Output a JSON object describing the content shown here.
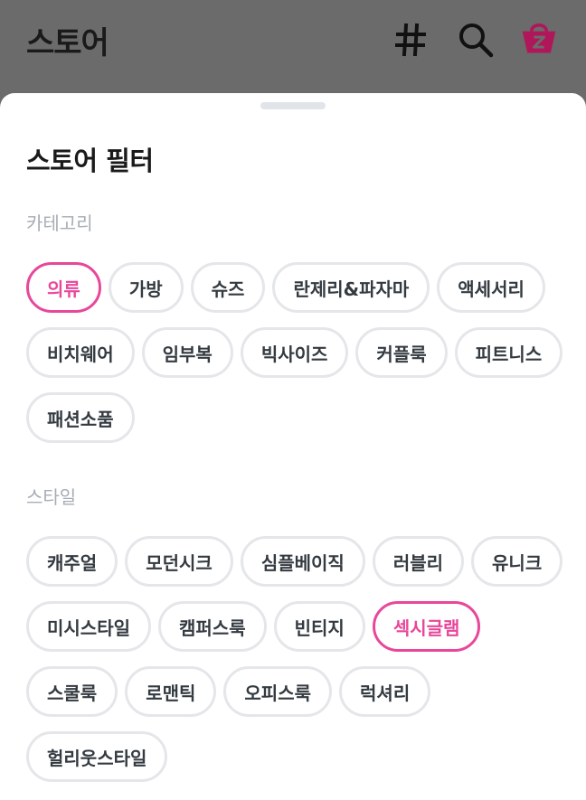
{
  "header": {
    "title": "스토어",
    "hash_icon": "hash-icon",
    "search_icon": "search-icon",
    "bag_icon": "shopping-bag-icon",
    "accent_color": "#b0175a"
  },
  "sheet": {
    "title": "스토어 필터"
  },
  "category": {
    "label": "카테고리",
    "chips": [
      {
        "label": "의류",
        "selected": true
      },
      {
        "label": "가방",
        "selected": false
      },
      {
        "label": "슈즈",
        "selected": false
      },
      {
        "label": "란제리&파자마",
        "selected": false
      },
      {
        "label": "액세서리",
        "selected": false
      },
      {
        "label": "비치웨어",
        "selected": false
      },
      {
        "label": "임부복",
        "selected": false
      },
      {
        "label": "빅사이즈",
        "selected": false
      },
      {
        "label": "커플룩",
        "selected": false
      },
      {
        "label": "피트니스",
        "selected": false
      },
      {
        "label": "패션소품",
        "selected": false
      }
    ]
  },
  "style": {
    "label": "스타일",
    "chips": [
      {
        "label": "캐주얼",
        "selected": false
      },
      {
        "label": "모던시크",
        "selected": false
      },
      {
        "label": "심플베이직",
        "selected": false
      },
      {
        "label": "러블리",
        "selected": false
      },
      {
        "label": "유니크",
        "selected": false
      },
      {
        "label": "미시스타일",
        "selected": false
      },
      {
        "label": "캠퍼스룩",
        "selected": false
      },
      {
        "label": "빈티지",
        "selected": false
      },
      {
        "label": "섹시글램",
        "selected": true
      },
      {
        "label": "스쿨룩",
        "selected": false
      },
      {
        "label": "로맨틱",
        "selected": false
      },
      {
        "label": "오피스룩",
        "selected": false
      },
      {
        "label": "럭셔리",
        "selected": false
      },
      {
        "label": "헐리웃스타일",
        "selected": false
      }
    ]
  },
  "colors": {
    "selected": "#e8479a",
    "chip_border": "#e4e6e9",
    "section_label": "#a7adb5"
  }
}
